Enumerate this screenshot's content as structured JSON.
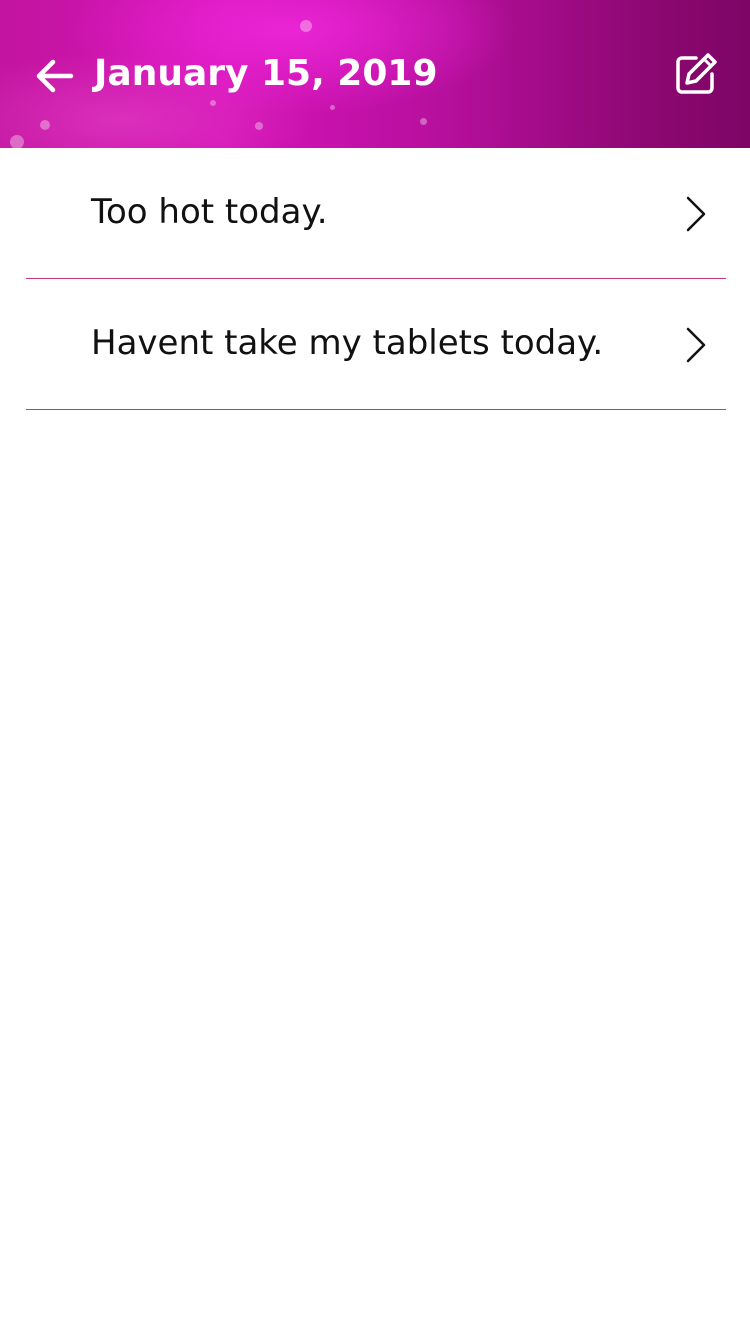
{
  "header": {
    "title": "January 15, 2019",
    "back_icon": "arrow-left-icon",
    "edit_icon": "edit-note-icon"
  },
  "entries": [
    {
      "text": "Too hot today.",
      "icon": "chevron-right-icon"
    },
    {
      "text": "Havent take my tablets today.",
      "icon": "chevron-right-icon"
    }
  ],
  "colors": {
    "header_primary": "#c2149f",
    "header_dark": "#7d0565",
    "divider": "#c0387a",
    "text": "#111111"
  }
}
